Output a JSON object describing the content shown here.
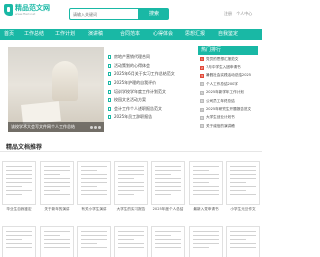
{
  "brand": {
    "title": "精品范文网",
    "url": "www.ffwd.net"
  },
  "search": {
    "placeholder": "请输入关键词",
    "button": "搜索"
  },
  "top_links": [
    "注册",
    "个人中心"
  ],
  "nav": [
    "首页",
    "工作总结",
    "工作计划",
    "演讲稿",
    "合同范本",
    "心得体会",
    "思想汇报",
    "自我鉴定"
  ],
  "hero": {
    "caption": "该校学术大会写文件网个人工作总结"
  },
  "hot_docs": [
    "房地产营销代理合同",
    "活动策划的心得体会",
    "2025年6月关于实习工作总结范文",
    "2025年护理的自我评价",
    "培训学校学年度工作计划范文",
    "校园文艺活动方案",
    "会计工作个人述职报告范文",
    "2025年员工辞职报告"
  ],
  "side": {
    "title": "热门排行",
    "items": [
      "党员的思想汇报范文",
      "7月中学生入团申请书",
      "暑假社会实践活动总结2025",
      "个人工作总结200字",
      "2025年新学年工作计划",
      "公司员工年终总结",
      "2025年研究生开题报告范文",
      "大学生创业计划书",
      "关于诚信的演讲稿"
    ]
  },
  "section": {
    "title": "精品文档推荐"
  },
  "cards_row1": [
    "毕业生自我鉴定",
    "关于新年的演讲",
    "有关小学生演讲",
    "大学生的实习报告",
    "2025年度个人总结",
    "最新入党申请书",
    "小学生元旦作文"
  ]
}
